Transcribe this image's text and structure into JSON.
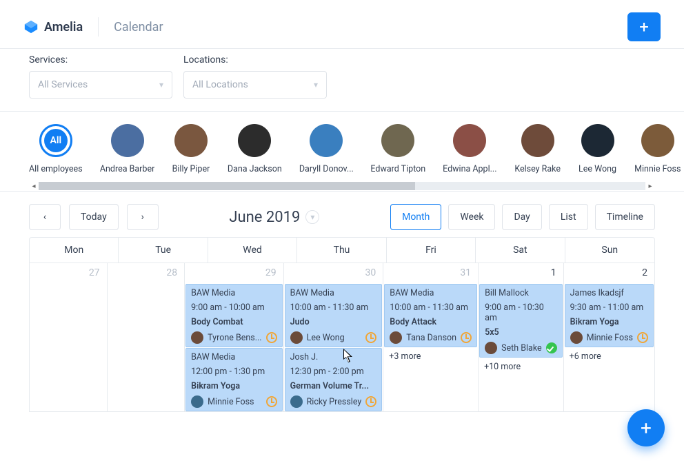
{
  "brand": "Amelia",
  "page_title": "Calendar",
  "filters": {
    "services_label": "Services:",
    "services_value": "All Services",
    "locations_label": "Locations:",
    "locations_value": "All Locations"
  },
  "employees": [
    {
      "name": "All employees",
      "badge": "All",
      "all": true
    },
    {
      "name": "Andrea Barber"
    },
    {
      "name": "Billy Piper"
    },
    {
      "name": "Dana Jackson"
    },
    {
      "name": "Daryll Donov..."
    },
    {
      "name": "Edward Tipton"
    },
    {
      "name": "Edwina Appl..."
    },
    {
      "name": "Kelsey Rake"
    },
    {
      "name": "Lee Wong"
    },
    {
      "name": "Minnie Foss"
    }
  ],
  "nav": {
    "today": "Today",
    "period": "June 2019",
    "views": {
      "month": "Month",
      "week": "Week",
      "day": "Day",
      "list": "List",
      "timeline": "Timeline"
    },
    "active_view": "month"
  },
  "weekday_headers": [
    "Mon",
    "Tue",
    "Wed",
    "Thu",
    "Fri",
    "Sat",
    "Sun"
  ],
  "cells": [
    {
      "day": "27",
      "muted": true
    },
    {
      "day": "28",
      "muted": true
    },
    {
      "day": "29",
      "muted": true,
      "events": [
        {
          "title": "BAW Media",
          "time": "9:00 am - 10:00 am",
          "service": "Body Combat",
          "staff": "Tyrone Bens...",
          "status": "pending"
        },
        {
          "title": "BAW Media",
          "time": "12:00 pm - 1:30 pm",
          "service": "Bikram Yoga",
          "staff": "Minnie Foss",
          "status": "pending"
        }
      ]
    },
    {
      "day": "30",
      "muted": true,
      "events": [
        {
          "title": "BAW Media",
          "time": "10:00 am - 11:30 am",
          "service": "Judo",
          "staff": "Lee Wong",
          "status": "pending"
        },
        {
          "title": "Josh J.",
          "time": "12:30 pm - 2:00 pm",
          "service": "German Volume Tr...",
          "staff": "Ricky Pressley",
          "status": "pending"
        }
      ]
    },
    {
      "day": "31",
      "muted": true,
      "events": [
        {
          "title": "BAW Media",
          "time": "10:00 am - 11:30 am",
          "service": "Body Attack",
          "staff": "Tana Danson",
          "status": "pending"
        }
      ],
      "more": "+3 more"
    },
    {
      "day": "1",
      "events": [
        {
          "title": "Bill Mallock",
          "time": "9:00 am - 10:30 am",
          "service": "5x5",
          "staff": "Seth Blake",
          "status": "approved"
        }
      ],
      "more": "+10 more"
    },
    {
      "day": "2",
      "events": [
        {
          "title": "James Ikadsjf",
          "time": "9:30 am - 11:00 am",
          "service": "Bikram Yoga",
          "staff": "Minnie Foss",
          "status": "pending"
        }
      ],
      "more": "+6 more"
    }
  ],
  "colors": {
    "accent": "#117ef3",
    "event_bg": "#bad9f9"
  }
}
